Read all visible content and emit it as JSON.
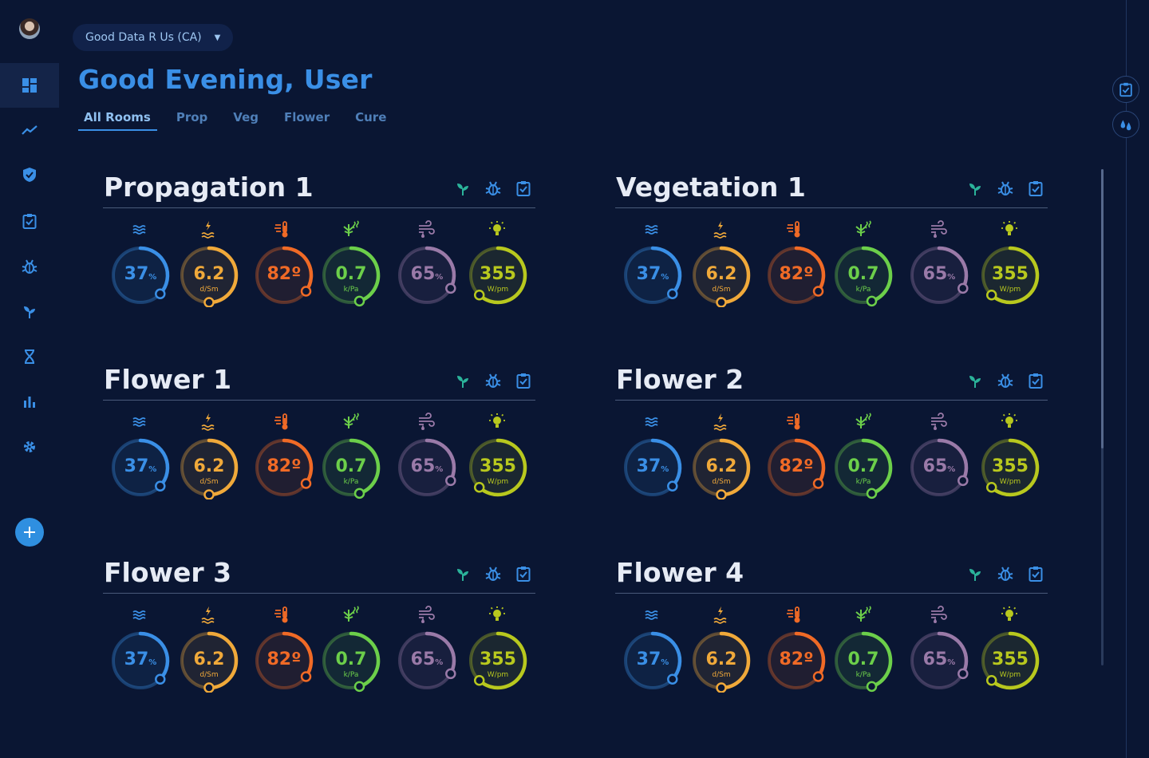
{
  "org": {
    "name": "Good Data R Us (CA)",
    "caret": "▼"
  },
  "greeting": "Good Evening, User",
  "tabs": [
    "All Rooms",
    "Prop",
    "Veg",
    "Flower",
    "Cure"
  ],
  "active_tab": 0,
  "sidebar": {
    "items": [
      {
        "icon": "dashboard-icon",
        "active": true
      },
      {
        "icon": "trend-line-icon"
      },
      {
        "icon": "shield-check-icon"
      },
      {
        "icon": "clipboard-check-icon"
      },
      {
        "icon": "bug-icon"
      },
      {
        "icon": "sprout-icon"
      },
      {
        "icon": "hourglass-icon"
      },
      {
        "icon": "bar-chart-icon"
      },
      {
        "icon": "gear-icon"
      }
    ],
    "add_icon": "plus-icon"
  },
  "rail": [
    "clipboard-check-icon",
    "water-drops-icon"
  ],
  "colors": {
    "humidity": "#3a8fe6",
    "ec": "#f0a93a",
    "temperature": "#f06a26",
    "vpd": "#6ccf4a",
    "soil": "#9a7aa8",
    "light": "#b8c81e",
    "accent": "#3a8fe6",
    "action_green": "#2bb39a",
    "action_blue": "#3a8fe6"
  },
  "metrics": [
    {
      "key": "humidity",
      "icon": "humidity-waves-icon",
      "value": "37",
      "unit_inline": "%",
      "unit": "",
      "level": 0.37
    },
    {
      "key": "ec",
      "icon": "ec-bolt-icon",
      "value": "6.2",
      "unit_inline": "",
      "unit": "d/Sm",
      "level": 0.5
    },
    {
      "key": "temperature",
      "icon": "thermometer-icon",
      "value": "82º",
      "unit_inline": "",
      "unit": "",
      "level": 0.35
    },
    {
      "key": "vpd",
      "icon": "vpd-leaf-icon",
      "value": "0.7",
      "unit_inline": "",
      "unit": "k/Pa",
      "level": 0.45
    },
    {
      "key": "soil",
      "icon": "soil-moisture-icon",
      "value": "65",
      "unit_inline": "%",
      "unit": "",
      "level": 0.33
    },
    {
      "key": "light",
      "icon": "light-bulb-icon",
      "value": "355",
      "unit_inline": "",
      "unit": "W/pm",
      "level": 0.62
    }
  ],
  "room_actions": [
    "sprout-icon",
    "bug-icon",
    "clipboard-check-icon"
  ],
  "rooms": [
    {
      "name": "Propagation 1"
    },
    {
      "name": "Vegetation 1"
    },
    {
      "name": "Flower 1"
    },
    {
      "name": "Flower 2"
    },
    {
      "name": "Flower 3"
    },
    {
      "name": "Flower 4"
    }
  ]
}
